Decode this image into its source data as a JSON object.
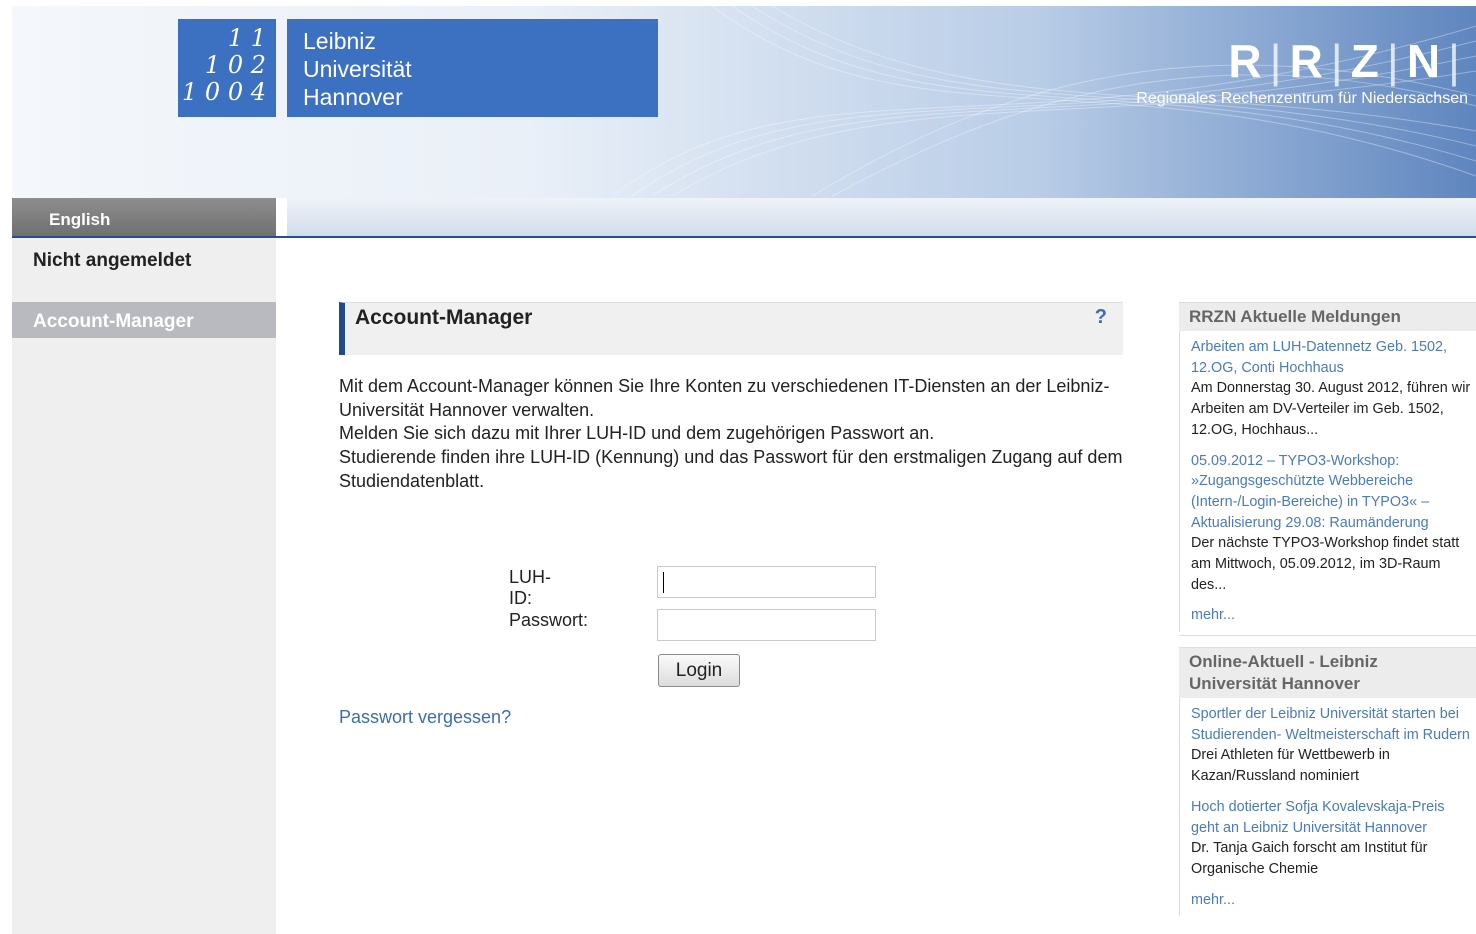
{
  "header": {
    "luh_numbers": [
      "1 1",
      "1 0 2",
      "1 0 0 4"
    ],
    "luh_name": [
      "Leibniz",
      "Universität",
      "Hannover"
    ],
    "rrzn_letters": [
      "R",
      "R",
      "Z",
      "N"
    ],
    "rrzn_subtitle": "Regionales Rechenzentrum für Niedersachsen"
  },
  "lang_tab": {
    "label": "English"
  },
  "sidebar": {
    "status": "Nicht angemeldet",
    "nav_account": "Account-Manager"
  },
  "main": {
    "title": "Account-Manager",
    "help": "?",
    "intro": [
      "Mit dem Account-Manager können Sie Ihre Konten zu verschiedenen IT-Diensten an der Leibniz-Universität Hannover verwalten.",
      "Melden Sie sich dazu mit Ihrer LUH-ID und dem zugehörigen Passwort an.",
      "Studierende finden ihre LUH-ID (Kennung) und das Passwort für den erstmaligen Zugang auf dem Studiendatenblatt."
    ],
    "form": {
      "luh_id_label": "LUH-ID:",
      "luh_id_value": "",
      "password_label": "Passwort:",
      "password_value": "",
      "login_label": "Login"
    },
    "forgot_password": "Passwort vergessen?"
  },
  "news": [
    {
      "heading": "RRZN Aktuelle Meldungen",
      "items": [
        {
          "title": "Arbeiten am LUH-Datennetz Geb. 1502, 12.OG, Conti Hochhaus",
          "text": "Am Donnerstag 30. August 2012, führen wir Arbeiten am DV-Verteiler im Geb. 1502, 12.OG, Hochhaus..."
        },
        {
          "title": "05.09.2012 – TYPO3-Workshop: »Zugangsgeschützte Webbereiche (Intern-/Login-Bereiche) in TYPO3« – Aktualisierung 29.08: Raumänderung",
          "text": "Der nächste TYPO3-Workshop findet statt am Mittwoch, 05.09.2012, im 3D-Raum des..."
        }
      ],
      "more": "mehr..."
    },
    {
      "heading": "Online-Aktuell - Leibniz Universität Hannover",
      "items": [
        {
          "title": "Sportler der Leibniz Universität starten bei Studierenden- Weltmeisterschaft im Rudern",
          "text": "Drei Athleten für Wettbewerb in Kazan/Russland nominiert"
        },
        {
          "title": "Hoch dotierter Sofja Kovalevskaja-Preis geht an Leibniz Universität Hannover",
          "text": "Dr. Tanja Gaich forscht am Institut für Organische Chemie"
        }
      ],
      "more": "mehr..."
    }
  ]
}
